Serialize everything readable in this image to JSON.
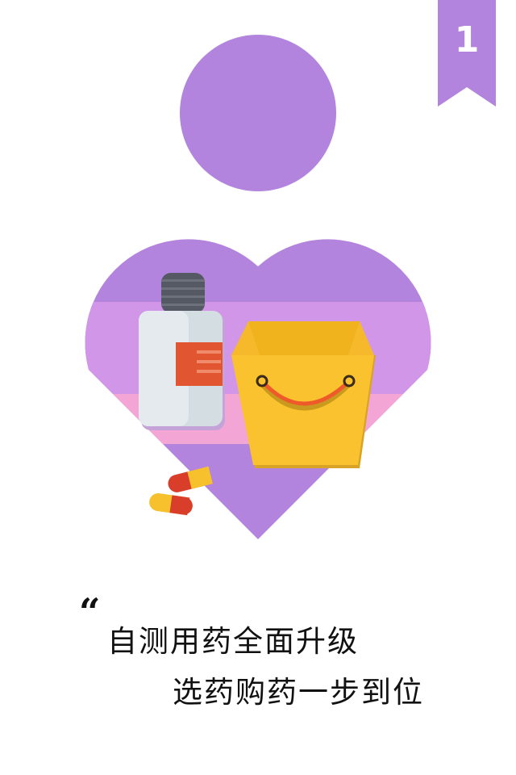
{
  "page_badge": {
    "number": "1"
  },
  "slogan": {
    "quote_mark": "“",
    "line1": "自测用药全面升级",
    "line2": "选药购药一步到位"
  },
  "illustration": {
    "icons": [
      "person-head-icon",
      "heart-icon",
      "medicine-bottle-icon",
      "shopping-bag-icon",
      "capsule-icon"
    ]
  },
  "colors": {
    "purple": "#b384dd",
    "light_purple": "#d296e8",
    "pink": "#f3a6d6",
    "bag_yellow": "#f9c22e",
    "bag_handle": "#ef5a2a",
    "bottle_label": "#e15530",
    "background": "#ffffff"
  }
}
